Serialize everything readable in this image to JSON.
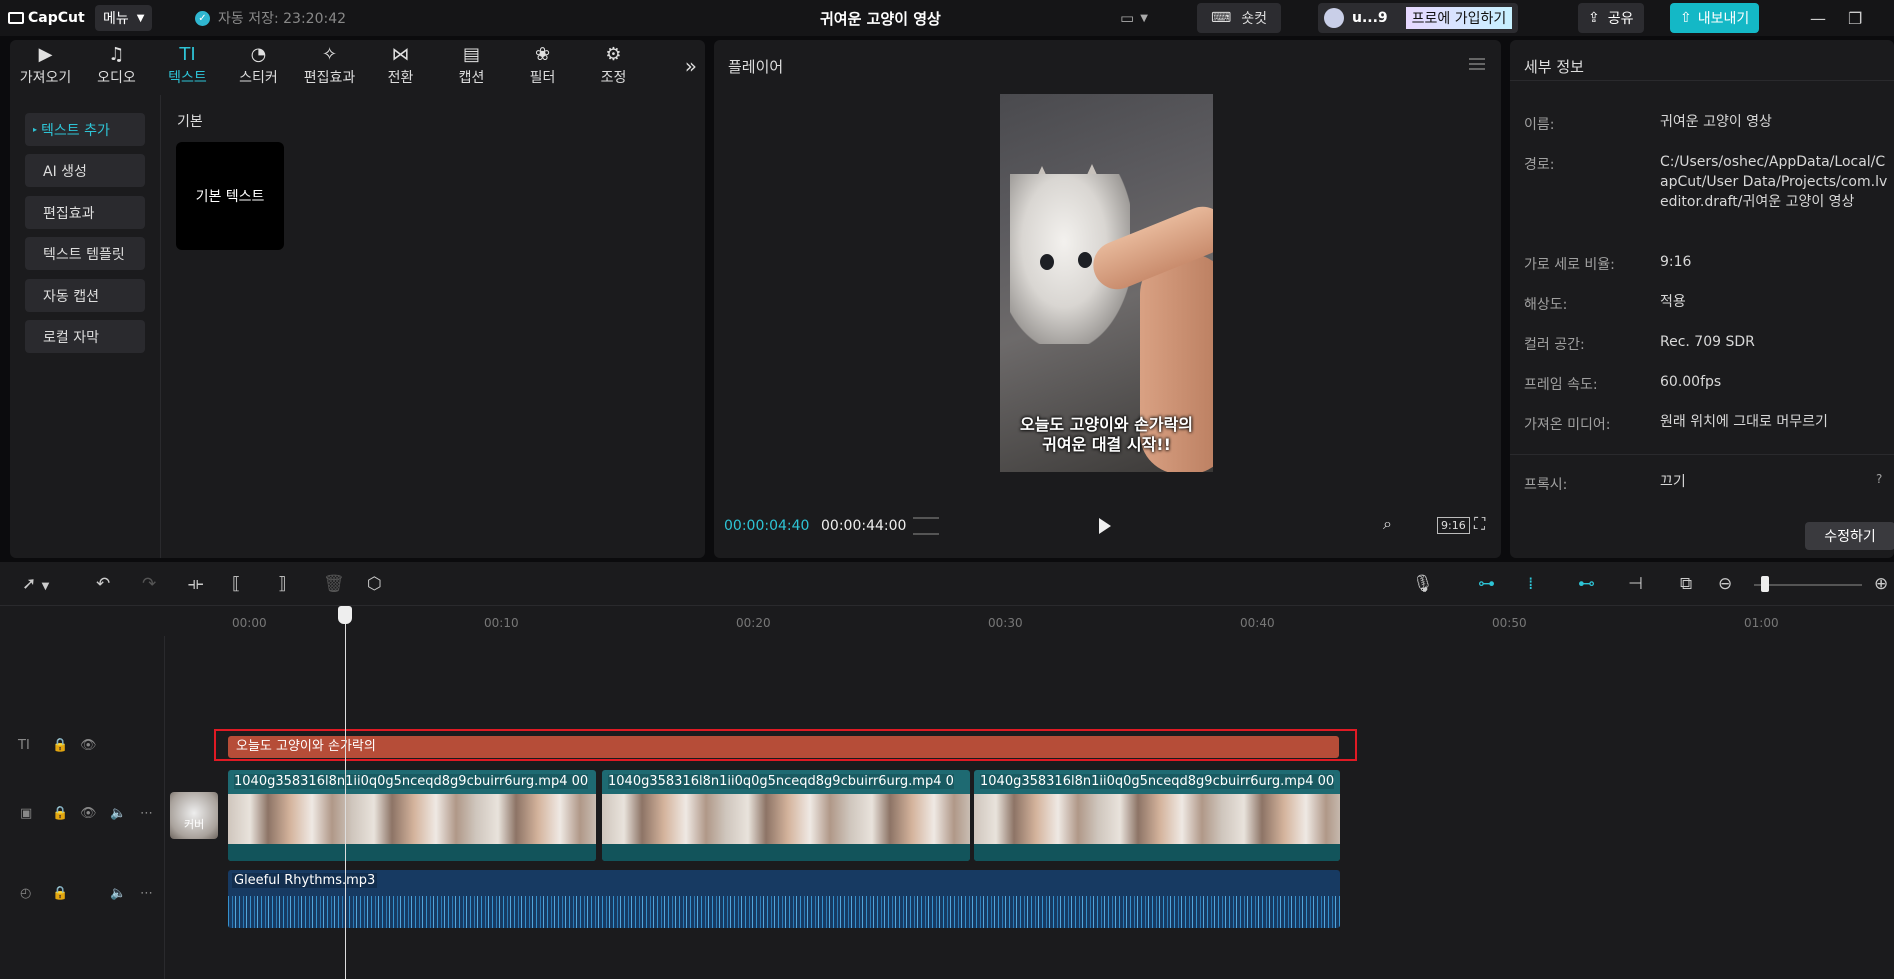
{
  "titlebar": {
    "app_name": "CapCut",
    "menu_label": "메뉴",
    "autosave": "자동 저장: 23:20:42",
    "project_title": "귀여운 고양이 영상",
    "shortcut_label": "숏컷",
    "user_name": "u...9",
    "pro_label": "프로에 가입하기",
    "share_label": "공유",
    "export_label": "내보내기"
  },
  "media_tabs": [
    {
      "label": "가져오기",
      "icon": "import-icon"
    },
    {
      "label": "오디오",
      "icon": "audio-icon"
    },
    {
      "label": "텍스트",
      "icon": "text-icon"
    },
    {
      "label": "스티커",
      "icon": "sticker-icon"
    },
    {
      "label": "편집효과",
      "icon": "effects-icon"
    },
    {
      "label": "전환",
      "icon": "transition-icon"
    },
    {
      "label": "캡션",
      "icon": "caption-icon"
    },
    {
      "label": "필터",
      "icon": "filter-icon"
    },
    {
      "label": "조정",
      "icon": "adjust-icon"
    }
  ],
  "text_sidebar": [
    "텍스트 추가",
    "AI 생성",
    "편집효과",
    "텍스트 템플릿",
    "자동 캡션",
    "로컬 자막"
  ],
  "text_panel": {
    "section": "기본",
    "card_label": "기본 텍스트"
  },
  "player": {
    "title": "플레이어",
    "caption_line1": "오늘도 고양이와 손가락의",
    "caption_line2": "귀여운 대결 시작!!",
    "current_time": "00:00:04:40",
    "total_time": "00:00:44:00",
    "ratio": "9:16"
  },
  "details": {
    "title": "세부 정보",
    "rows": [
      {
        "label": "이름:",
        "value": "귀여운 고양이 영상"
      },
      {
        "label": "경로:",
        "value": "C:/Users/oshec/AppData/Local/CapCut/User Data/Projects/com.lveditor.draft/귀여운 고양이 영상"
      },
      {
        "label": "가로 세로 비율:",
        "value": "9:16"
      },
      {
        "label": "해상도:",
        "value": "적용"
      },
      {
        "label": "컬러 공간:",
        "value": "Rec. 709 SDR"
      },
      {
        "label": "프레임 속도:",
        "value": "60.00fps"
      },
      {
        "label": "가져온 미디어:",
        "value": "원래 위치에 그대로 머무르기"
      },
      {
        "label": "프록시:",
        "value": "끄기"
      }
    ],
    "edit_label": "수정하기"
  },
  "timeline": {
    "ruler": [
      "00:00",
      "00:10",
      "00:20",
      "00:30",
      "00:40",
      "00:50",
      "01:00"
    ],
    "text_clip": "오늘도 고양이와 손가락의",
    "video_clips": [
      {
        "name": "1040g358316l8n1ii0q0g5nceqd8g9cbuirr6urg.mp4",
        "dur": "00"
      },
      {
        "name": "1040g358316l8n1ii0q0g5nceqd8g9cbuirr6urg.mp4",
        "dur": "0"
      },
      {
        "name": "1040g358316l8n1ii0q0g5nceqd8g9cbuirr6urg.mp4",
        "dur": "00"
      }
    ],
    "cover_label": "커버",
    "audio_clip": "Gleeful Rhythms.mp3"
  },
  "colors": {
    "accent": "#2ec4d6",
    "text_clip": "#b64d38",
    "video_clip": "#1e6a72",
    "audio_clip": "#173a62",
    "selection": "#e01a24"
  }
}
